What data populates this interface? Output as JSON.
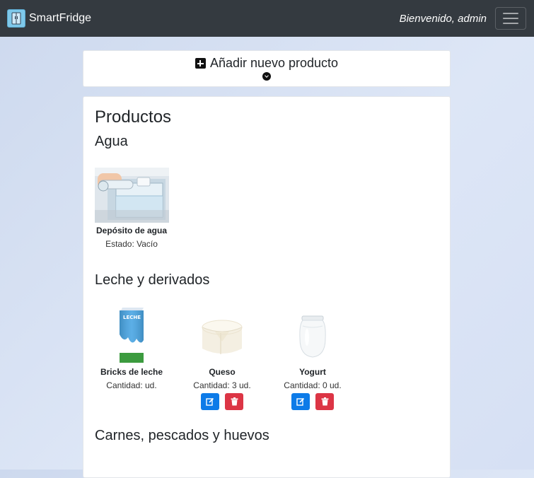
{
  "navbar": {
    "brand": "SmartFridge",
    "welcome": "Bienvenido, admin",
    "brand_icon": "fridge-icon",
    "menu_icon": "hamburger-icon"
  },
  "add_product": {
    "label": "Añadir nuevo producto",
    "icon": "plus-square-icon",
    "toggle_icon": "chevron-circle-down-icon"
  },
  "products": {
    "title": "Productos",
    "sections": [
      {
        "title": "Agua",
        "items": [
          {
            "name": "Depósito de agua",
            "detail": "Estado: Vacío",
            "image": "water-tank-image"
          }
        ]
      },
      {
        "title": "Leche y derivados",
        "items": [
          {
            "name": "Bricks de leche",
            "detail": "Cantidad: ud.",
            "image": "milk-carton-image"
          },
          {
            "name": "Queso",
            "detail": "Cantidad: 3 ud.",
            "image": "cheese-image"
          },
          {
            "name": "Yogurt",
            "detail": "Cantidad: 0 ud.",
            "image": "yogurt-jar-image"
          }
        ]
      },
      {
        "title": "Carnes, pescados y huevos",
        "items": []
      }
    ]
  },
  "colors": {
    "navbar": "#343a40",
    "edit_button": "#0d7be8",
    "delete_button": "#dc3545",
    "brand_icon": "#7ec8ea"
  }
}
